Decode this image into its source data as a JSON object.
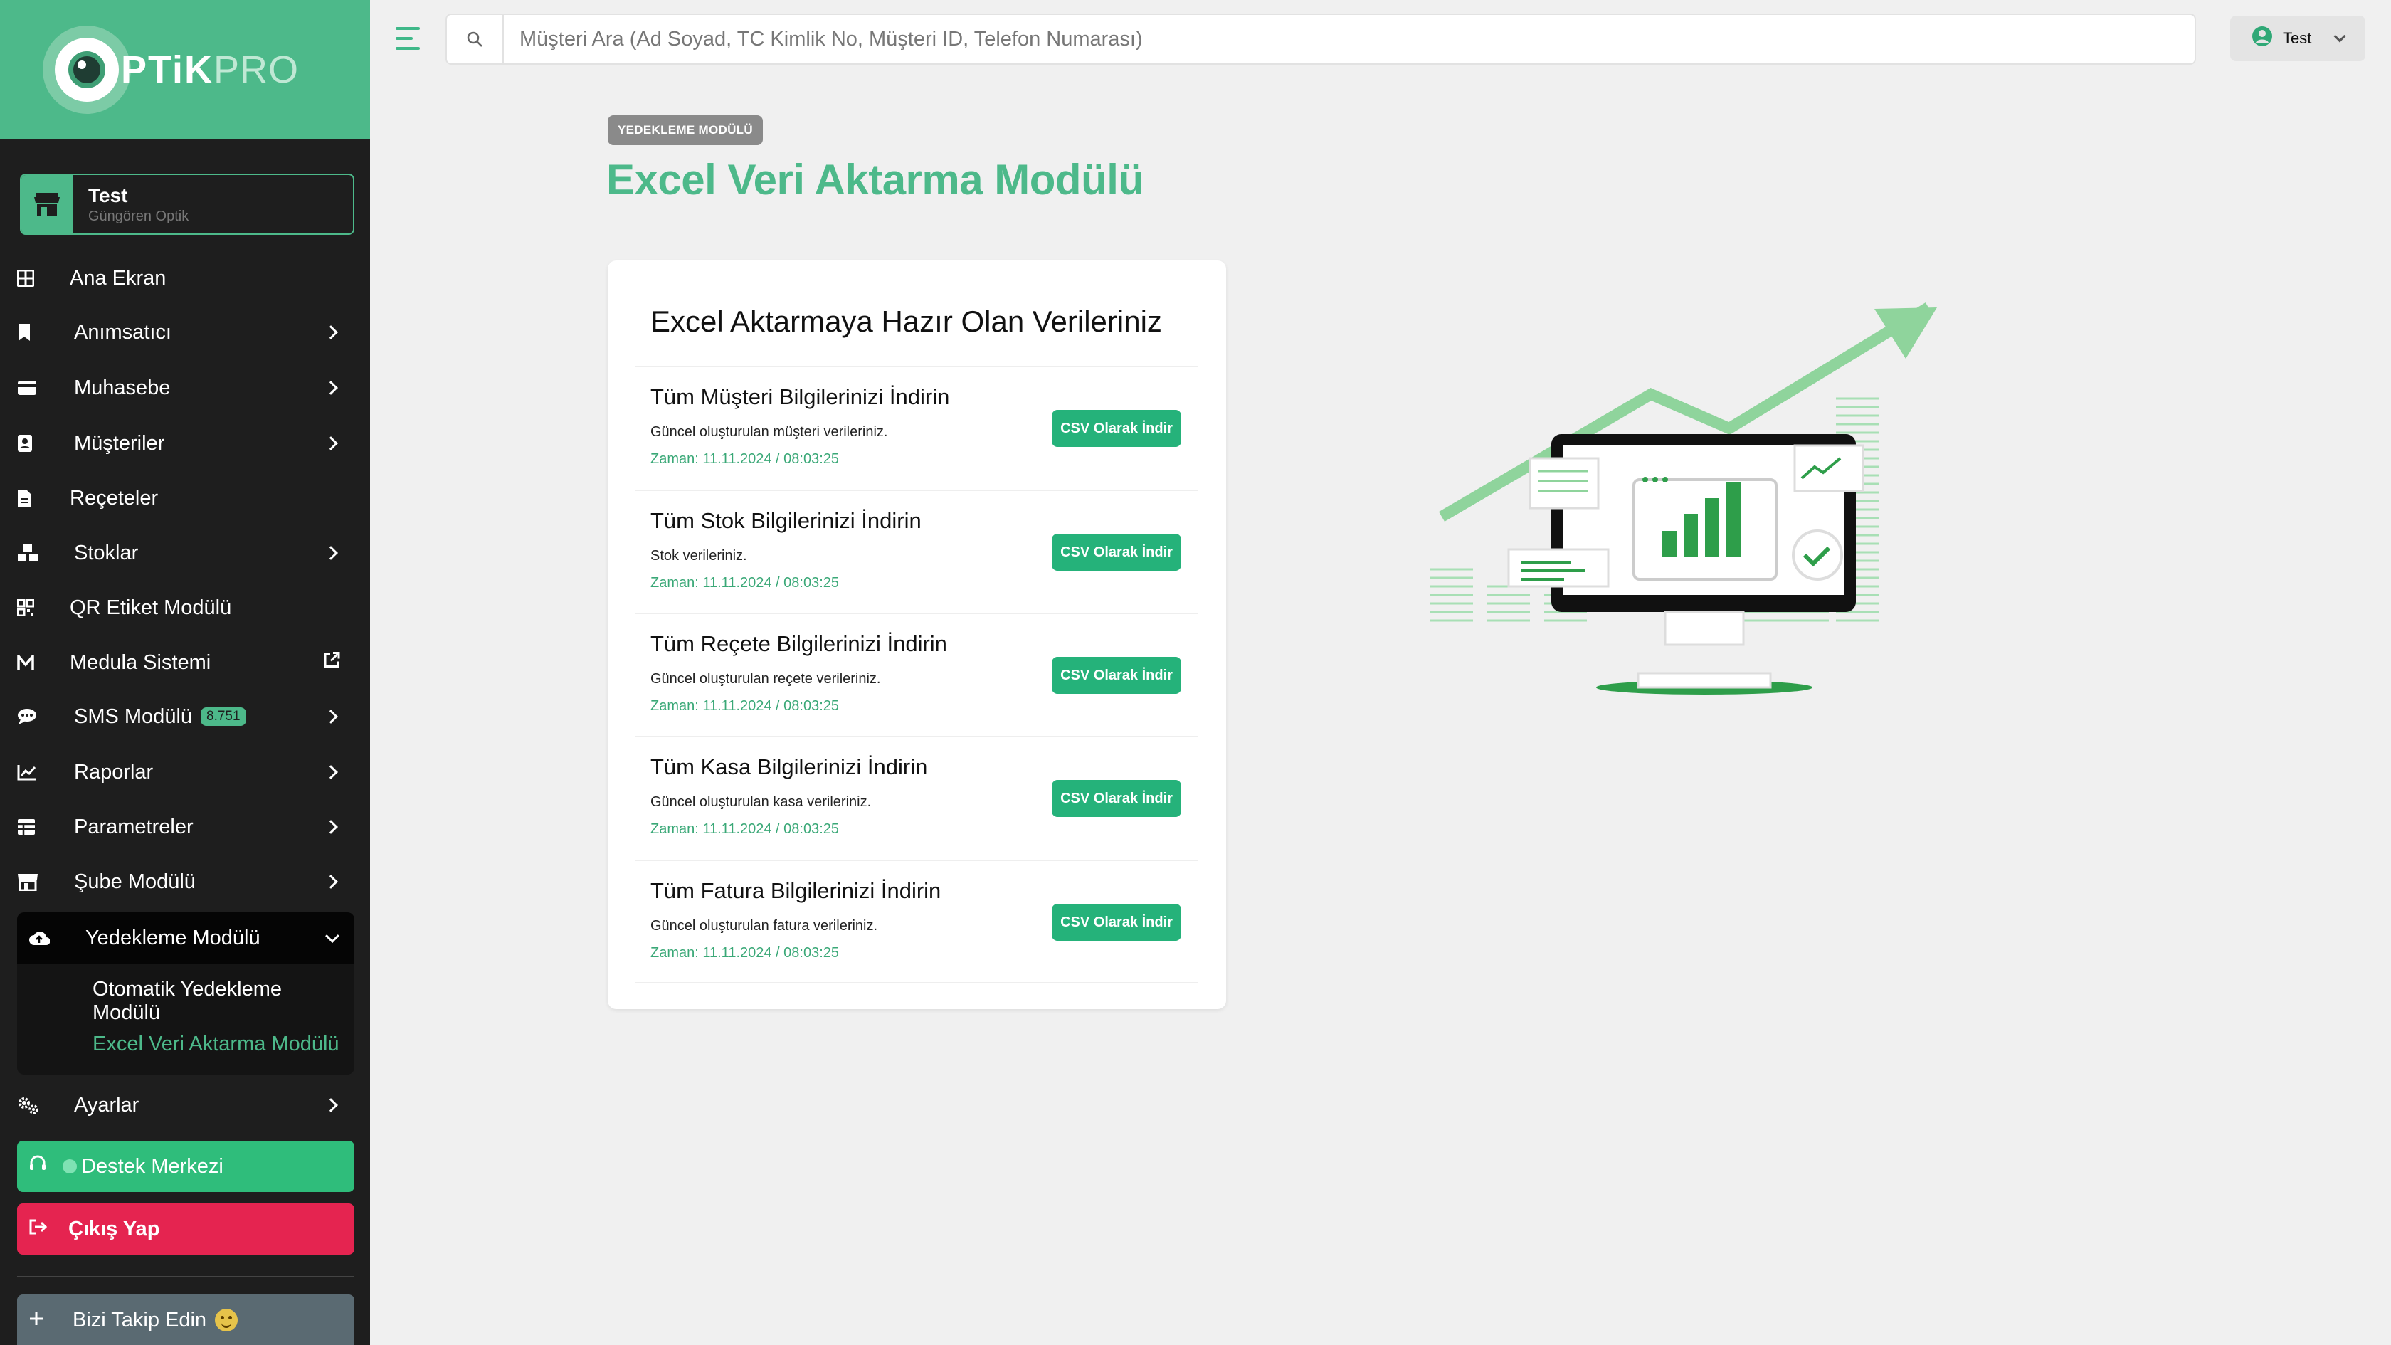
{
  "logo": {
    "part1": "PTiK",
    "part2": "PRO"
  },
  "branch": {
    "name": "Test",
    "subtitle": "Güngören Optik"
  },
  "sidebar": {
    "items": [
      {
        "label": "Ana Ekran"
      },
      {
        "label": "Anımsatıcı"
      },
      {
        "label": "Muhasebe"
      },
      {
        "label": "Müşteriler"
      },
      {
        "label": "Reçeteler"
      },
      {
        "label": "Stoklar"
      },
      {
        "label": "QR Etiket Modülü"
      },
      {
        "label": "Medula Sistemi"
      },
      {
        "label": "SMS Modülü",
        "badge": "8.751"
      },
      {
        "label": "Raporlar"
      },
      {
        "label": "Parametreler"
      },
      {
        "label": "Şube Modülü"
      },
      {
        "label": "Yedekleme Modülü"
      },
      {
        "label": "Ayarlar"
      }
    ],
    "sub_items": [
      {
        "label": "Otomatik Yedekleme Modülü"
      },
      {
        "label": "Excel Veri Aktarma Modülü"
      }
    ],
    "support": "Destek Merkezi",
    "logout": "Çıkış Yap",
    "follow": "Bizi Takip Edin"
  },
  "search": {
    "placeholder": "Müşteri Ara (Ad Soyad, TC Kimlik No, Müşteri ID, Telefon Numarası)"
  },
  "user": {
    "name": "Test"
  },
  "page": {
    "badge": "YEDEKLEME MODÜLÜ",
    "title": "Excel Veri Aktarma Modülü"
  },
  "card": {
    "title": "Excel Aktarmaya Hazır Olan Verileriniz",
    "button_label": "CSV Olarak İndir",
    "rows": [
      {
        "title": "Tüm Müşteri Bilgilerinizi İndirin",
        "desc": "Güncel oluşturulan müşteri verileriniz.",
        "time": "Zaman: 11.11.2024 / 08:03:25"
      },
      {
        "title": "Tüm Stok Bilgilerinizi İndirin",
        "desc": "Stok verileriniz.",
        "time": "Zaman: 11.11.2024 / 08:03:25"
      },
      {
        "title": "Tüm Reçete Bilgilerinizi İndirin",
        "desc": "Güncel oluşturulan reçete verileriniz.",
        "time": "Zaman: 11.11.2024 / 08:03:25"
      },
      {
        "title": "Tüm Kasa Bilgilerinizi İndirin",
        "desc": "Güncel oluşturulan kasa verileriniz.",
        "time": "Zaman: 11.11.2024 / 08:03:25"
      },
      {
        "title": "Tüm Fatura Bilgilerinizi İndirin",
        "desc": "Güncel oluşturulan fatura verileriniz.",
        "time": "Zaman: 11.11.2024 / 08:03:25"
      }
    ]
  },
  "colors": {
    "brand": "#4db98a",
    "sidebar_bg": "#1e1e1e",
    "support": "#2fbd7b",
    "logout": "#e52450",
    "button": "#25b27a"
  }
}
